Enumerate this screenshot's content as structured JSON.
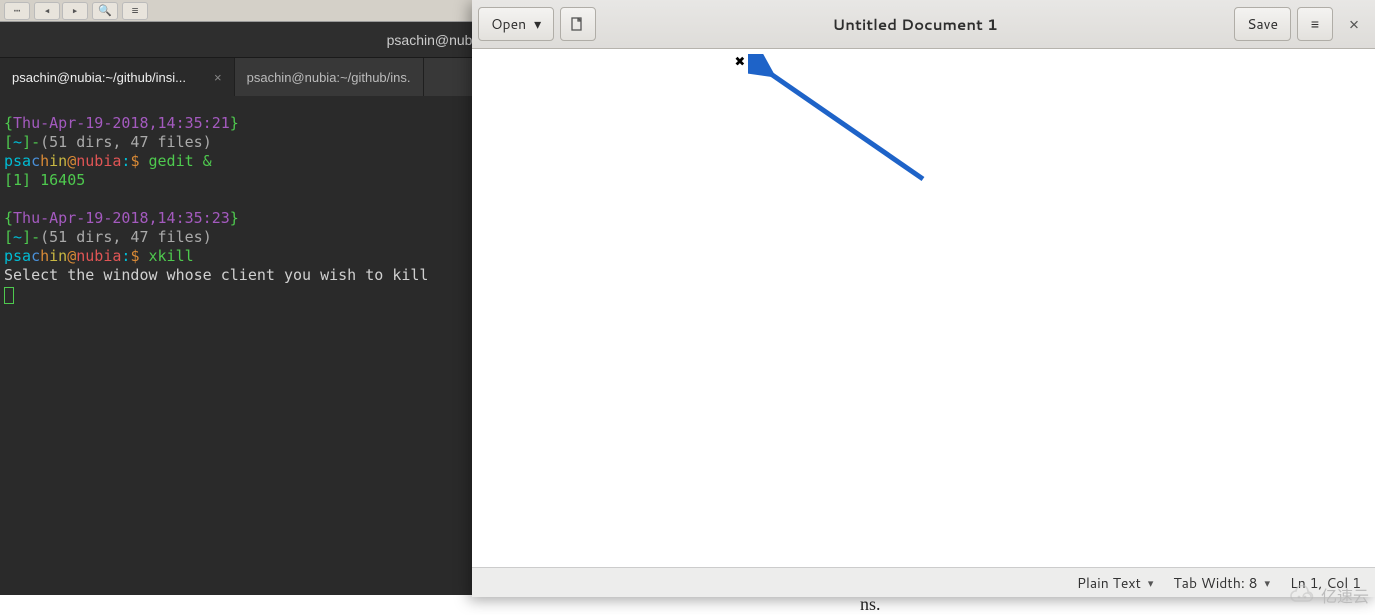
{
  "terminal": {
    "title": "psachin@nubia",
    "tabs": [
      {
        "label": "psachin@nubia:~/github/insi...",
        "active": true
      },
      {
        "label": "psachin@nubia:~/github/ins.",
        "active": false
      }
    ],
    "lines": {
      "ts1": "Thu-Apr-19-2018,14:35:21",
      "dirinfo1_a": "51 dirs, 47 files",
      "user1_a": "psa",
      "user1_b": "c",
      "user1_c": "h",
      "user1_d": "in",
      "host1": "nubia",
      "cmd1": "gedit &",
      "job1": "[1] 16405",
      "ts2": "Thu-Apr-19-2018,14:35:23",
      "dirinfo2_a": "51 dirs, 47 files",
      "cmd2": "xkill",
      "kill_msg": "Select the window whose client you wish to kill"
    }
  },
  "gedit": {
    "open_label": "Open",
    "title": "Untitled Document 1",
    "save_label": "Save",
    "status": {
      "syntax": "Plain Text",
      "tabwidth": "Tab Width: 8",
      "position": "Ln 1, Col 1"
    }
  },
  "watermark": {
    "text": "亿速云"
  },
  "crop": "ns."
}
